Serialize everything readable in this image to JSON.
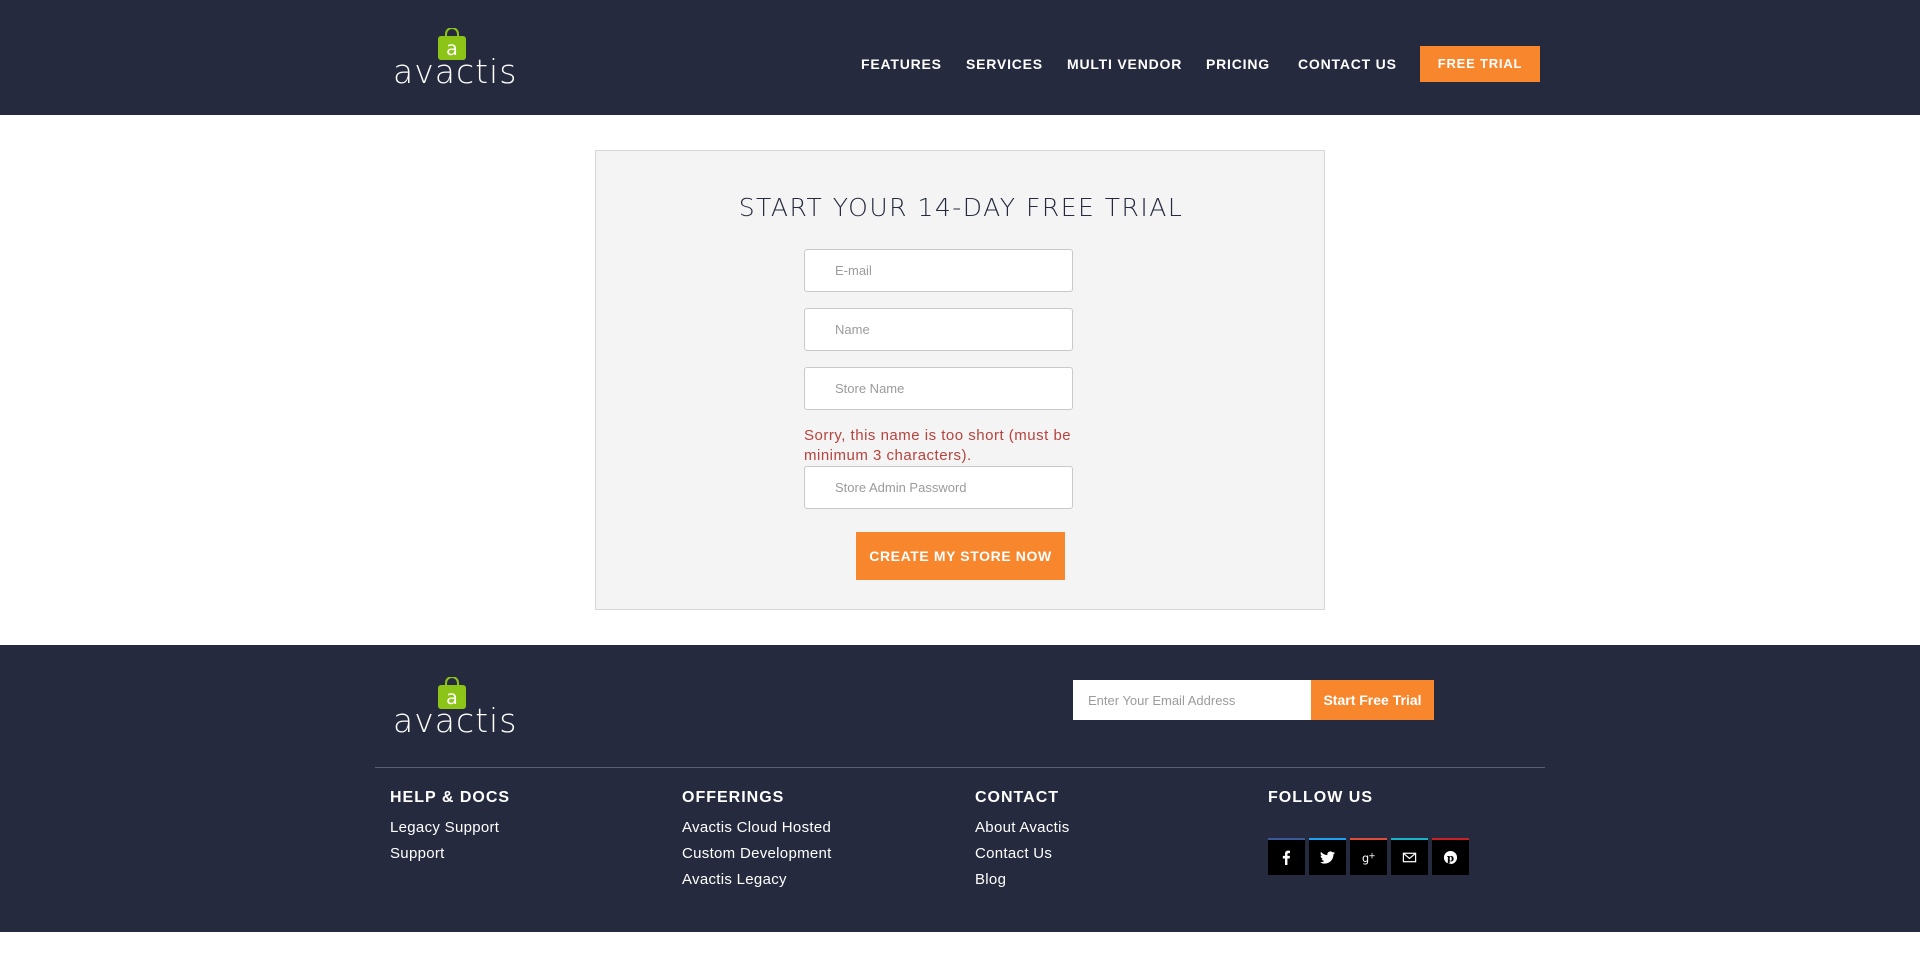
{
  "header": {
    "logo_text": "avactis",
    "logo_letter": "a",
    "nav": [
      {
        "label": "FEATURES"
      },
      {
        "label": "SERVICES"
      },
      {
        "label": "MULTI VENDOR"
      },
      {
        "label": "PRICING"
      },
      {
        "label": "CONTACT US"
      }
    ],
    "cta_label": "FREE TRIAL"
  },
  "form": {
    "title": "START YOUR 14-DAY FREE TRIAL",
    "email_placeholder": "E-mail",
    "name_placeholder": "Name",
    "store_name_placeholder": "Store Name",
    "error_message": "Sorry, this name is too short (must be minimum 3 characters).",
    "password_placeholder": "Store Admin Password",
    "submit_label": "CREATE MY STORE NOW"
  },
  "footer": {
    "logo_text": "avactis",
    "logo_letter": "a",
    "subscribe_placeholder": "Enter Your Email Address",
    "subscribe_button": "Start Free Trial",
    "columns": [
      {
        "title": "HELP & DOCS",
        "links": [
          "Legacy Support",
          "Support"
        ]
      },
      {
        "title": "OFFERINGS",
        "links": [
          "Avactis Cloud Hosted",
          "Custom Development",
          "Avactis Legacy"
        ]
      },
      {
        "title": "CONTACT",
        "links": [
          "About Avactis",
          "Contact Us",
          "Blog"
        ]
      },
      {
        "title": "FOLLOW US",
        "links": []
      }
    ],
    "social": [
      {
        "icon": "facebook-icon",
        "accent": "#3b5998"
      },
      {
        "icon": "twitter-icon",
        "accent": "#1da1f2"
      },
      {
        "icon": "google-plus-icon",
        "accent": "#dd4b39"
      },
      {
        "icon": "email-icon",
        "accent": "#17b3c9"
      },
      {
        "icon": "pinterest-icon",
        "accent": "#cb2027"
      }
    ]
  },
  "colors": {
    "navy": "#252a3e",
    "orange": "#f7862d",
    "logo_green": "#8dc418",
    "error": "#b5443f",
    "card_bg": "#f4f4f4"
  }
}
